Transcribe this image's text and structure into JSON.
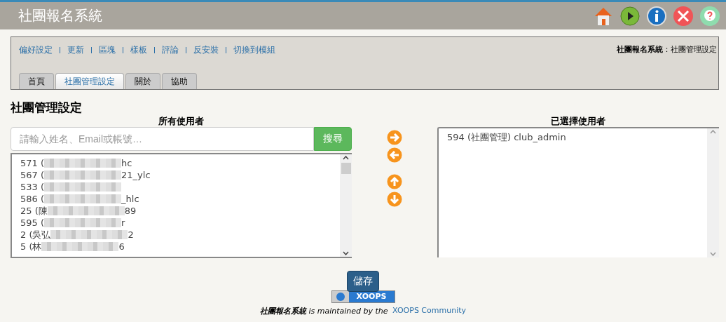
{
  "header": {
    "title": "社團報名系統"
  },
  "admin_menu": {
    "links": [
      "偏好設定",
      "更新",
      "區塊",
      "樣板",
      "評論",
      "反安裝",
      "切換到模組"
    ],
    "breadcrumb": {
      "module": "社團報名系統",
      "separator": "：",
      "page": "社團管理設定"
    },
    "tabs": [
      {
        "label": "首頁",
        "selected": false
      },
      {
        "label": "社團管理設定",
        "selected": true
      },
      {
        "label": "關於",
        "selected": false
      },
      {
        "label": "協助",
        "selected": false
      }
    ]
  },
  "page_title": "社團管理設定",
  "all_users": {
    "heading": "所有使用者",
    "search": {
      "placeholder": "請輸入姓名、Email或帳號…",
      "button": "搜尋"
    },
    "rows": [
      {
        "start": "571 (",
        "end": "hc"
      },
      {
        "start": "567 (",
        "end": "21_ylc"
      },
      {
        "start": "533 (",
        "end": ""
      },
      {
        "start": "586 (",
        "end": "_hlc"
      },
      {
        "start": "25 (陳",
        "end": "89"
      },
      {
        "start": "595 (",
        "end": "r"
      },
      {
        "start": "2 (吳弘",
        "end": "2"
      },
      {
        "start": "5 (林",
        "end": "6"
      }
    ]
  },
  "selected_users": {
    "heading": "已選擇使用者",
    "rows": [
      "594 (社團管理) club_admin"
    ]
  },
  "save_button": "儲存",
  "footer": {
    "badge": "XOOPS",
    "module": "社團報名系統",
    "text": " is maintained by the ",
    "link": "XOOPS Community"
  }
}
